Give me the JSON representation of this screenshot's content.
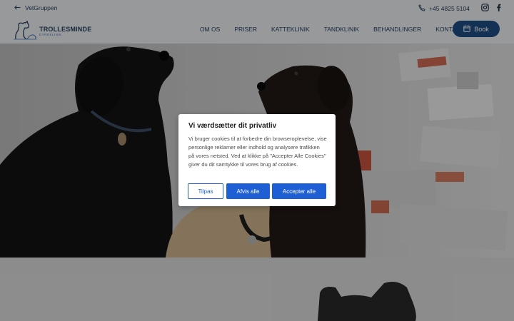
{
  "topbar": {
    "back_label": "VetGruppen",
    "phone": "+45 4825 5104"
  },
  "logo": {
    "name": "TROLLESMINDE",
    "sub": "DYREKLINIK"
  },
  "nav": {
    "items": [
      {
        "label": "OM OS"
      },
      {
        "label": "PRISER"
      },
      {
        "label": "KATTEKLINIK"
      },
      {
        "label": "TANDKLINIK"
      },
      {
        "label": "BEHANDLINGER"
      },
      {
        "label": "KONTAKT"
      }
    ],
    "book_label": "Book"
  },
  "cookie_modal": {
    "title": "Vi værdsætter dit privatliv",
    "body": "Vi bruger cookies til at forbedre din browseroplevelse, vise personlige reklamer eller indhold og analysere trafikken på vores netsted. Ved at klikke på \"Accepter Alle Cookies\" giver du dit samtykke til vores brug af cookies.",
    "customize_label": "Tilpas",
    "reject_label": "Afvis alle",
    "accept_label": "Accepter alle"
  },
  "colors": {
    "brand_navy": "#27415f",
    "book_button": "#1f4e86",
    "cookie_button_blue": "#1f5fd6",
    "overlay": "rgba(0,0,0,0.36)"
  },
  "icons": [
    "arrow-left-icon",
    "phone-icon",
    "instagram-icon",
    "facebook-icon",
    "calendar-icon",
    "dog-logo-icon"
  ]
}
